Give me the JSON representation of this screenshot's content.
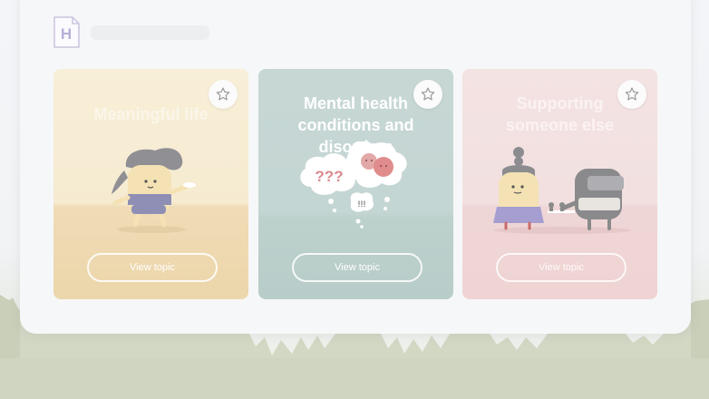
{
  "app": {
    "logo_letter": "H",
    "header_placeholder": ""
  },
  "cards": [
    {
      "title": "Meaningful life",
      "button_label": "View topic",
      "star_icon": "star-outline-icon"
    },
    {
      "title": "Mental health conditions and disorders",
      "title_line1": "Mental health",
      "title_line2": "conditions and disorders",
      "button_label": "View topic",
      "star_icon": "star-outline-icon",
      "thought_text_1": "???",
      "thought_text_2": "!!!"
    },
    {
      "title": "Supporting someone else",
      "title_line1": "Supporting",
      "title_line2": "someone else",
      "button_label": "View topic",
      "star_icon": "star-outline-icon"
    }
  ],
  "colors": {
    "accent": "#8a7bc0",
    "card_1_bg": "#f8efd8",
    "card_2_bg": "#c6d7d4",
    "card_3_bg": "#f4e3e3"
  }
}
